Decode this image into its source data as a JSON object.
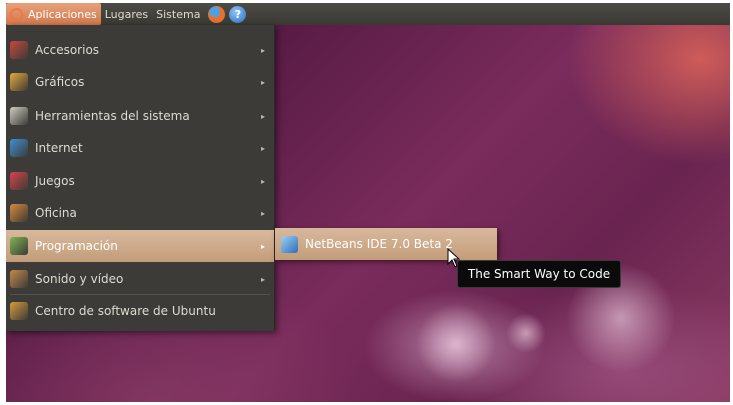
{
  "panel": {
    "menus": [
      {
        "label": "Aplicaciones",
        "active": true
      },
      {
        "label": "Lugares",
        "active": false
      },
      {
        "label": "Sistema",
        "active": false
      }
    ],
    "launchers": [
      {
        "icon": "firefox-icon"
      },
      {
        "icon": "help-icon",
        "glyph": "?"
      }
    ]
  },
  "menu": {
    "items": [
      {
        "label": "Accesorios",
        "icon": "accessories-icon",
        "color": "#c9473f",
        "submenu": true
      },
      {
        "label": "Gráficos",
        "icon": "graphics-icon",
        "color": "#e6a83a",
        "submenu": true
      },
      {
        "label": "Herramientas del sistema",
        "icon": "system-tools-icon",
        "color": "#cfcbc2",
        "submenu": true
      },
      {
        "label": "Internet",
        "icon": "internet-icon",
        "color": "#3f8fd6",
        "submenu": true
      },
      {
        "label": "Juegos",
        "icon": "games-icon",
        "color": "#d9434a",
        "submenu": true
      },
      {
        "label": "Oficina",
        "icon": "office-icon",
        "color": "#d98a3a",
        "submenu": true
      },
      {
        "label": "Programación",
        "icon": "programming-icon",
        "color": "#7db552",
        "submenu": true,
        "highlighted": true
      },
      {
        "label": "Sonido y vídeo",
        "icon": "sound-video-icon",
        "color": "#c58a4a",
        "submenu": true
      },
      {
        "label": "Centro de software de Ubuntu",
        "icon": "software-center-icon",
        "color": "#d79a3c",
        "submenu": false
      }
    ],
    "arrow_glyph": "▸"
  },
  "submenu": {
    "item_label": "NetBeans IDE 7.0 Beta 2",
    "icon": "netbeans-icon"
  },
  "tooltip": {
    "text": "The Smart Way to Code"
  },
  "colors": {
    "panel_bg": "#3c3b37",
    "highlight": "#c8a27e",
    "active_menu": "#dd8a5e",
    "wallpaper": "#5c1d48"
  }
}
